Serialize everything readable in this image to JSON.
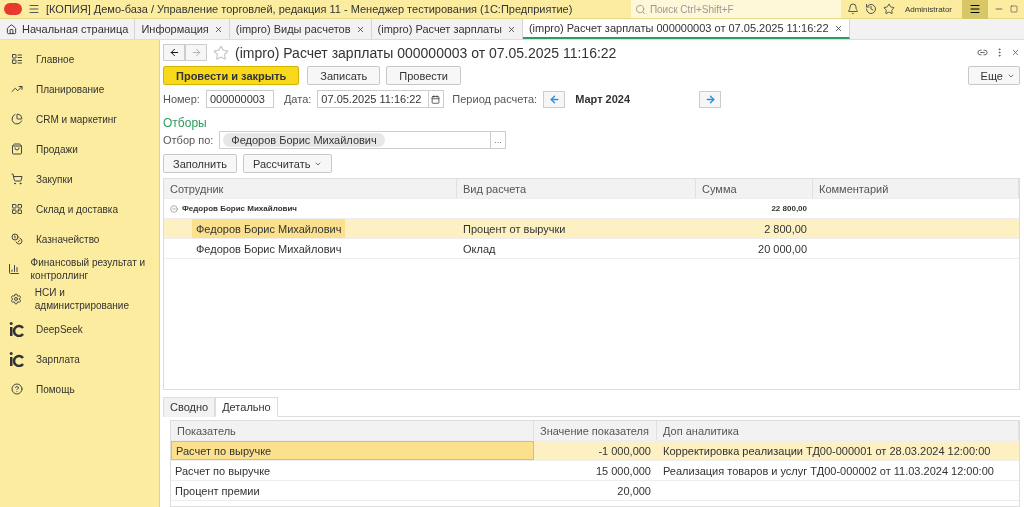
{
  "header": {
    "title": "[КОПИЯ] Демо-база / Управление торговлей, редакция 11  - Менеджер тестирования (1С:Предприятие)",
    "search_placeholder": "Поиск Ctrl+Shift+F",
    "user": "Administrator"
  },
  "tabs": [
    {
      "label": "Начальная страница",
      "selected": false,
      "closable": false
    },
    {
      "label": "Информация",
      "selected": false,
      "closable": true
    },
    {
      "label": "(impro) Виды расчетов",
      "selected": false,
      "closable": true
    },
    {
      "label": "(impro) Расчет зарплаты",
      "selected": false,
      "closable": true
    },
    {
      "label": "(impro) Расчет зарплаты 000000003 от 07.05.2025 11:16:22",
      "selected": true,
      "closable": true
    }
  ],
  "sidebar": {
    "items": [
      {
        "label": "Главное"
      },
      {
        "label": "Планирование"
      },
      {
        "label": "CRM и маркетинг"
      },
      {
        "label": "Продажи"
      },
      {
        "label": "Закупки"
      },
      {
        "label": "Склад и доставка"
      },
      {
        "label": "Казначейство"
      },
      {
        "label": "Финансовый результат и контроллинг"
      },
      {
        "label": "НСИ и администрирование"
      },
      {
        "label": "DeepSeek"
      },
      {
        "label": "Зарплата"
      },
      {
        "label": "Помощь"
      }
    ]
  },
  "form": {
    "title": "(impro) Расчет зарплаты 000000003 от 07.05.2025 11:16:22",
    "commands": [
      {
        "label": "Провести и закрыть",
        "kind": "primary"
      },
      {
        "label": "Записать",
        "kind": "normal"
      },
      {
        "label": "Провести",
        "kind": "normal"
      }
    ],
    "more": "Еще",
    "number_label": "Номер:",
    "number": "000000003",
    "date_label": "Дата:",
    "date": "07.05.2025 11:16:22",
    "period_label": "Период расчета:",
    "period": "Март 2024",
    "filters_heading": "Отборы",
    "filter_label": "Отбор по:",
    "filter_value": "Федоров Борис Михайлович",
    "filter_button": "...",
    "actions": [
      {
        "label": "Заполнить",
        "dropdown": false
      },
      {
        "label": "Рассчитать",
        "dropdown": true
      }
    ],
    "table": {
      "columns": [
        "Сотрудник",
        "Вид расчета",
        "Сумма",
        "Комментарий"
      ],
      "rows": [
        {
          "employee": "Федоров Борис Михайлович",
          "amount": "22 800,00",
          "expanded": true,
          "children": [
            {
              "employee": "Федоров Борис Михайлович",
              "calc_type": "Процент от выручки",
              "amount": "2 800,00",
              "selected": true
            },
            {
              "employee": "Федоров Борис Михайлович",
              "calc_type": "Оклад",
              "amount": "20 000,00",
              "selected": false
            }
          ]
        }
      ]
    },
    "detail_tabs": [
      {
        "label": "Сводно",
        "selected": false
      },
      {
        "label": "Детально",
        "selected": true
      }
    ],
    "detail_table": {
      "columns": [
        "Показатель",
        "Значение показателя",
        "Доп аналитика"
      ],
      "rows": [
        {
          "indicator": "Расчет по выручке",
          "value": "-1 000,000",
          "analytics": "Корректировка реализации ТД00-000001 от 28.03.2024 12:00:00",
          "selected": true
        },
        {
          "indicator": "Расчет по выручке",
          "value": "15 000,000",
          "analytics": "Реализация товаров и услуг ТД00-000002 от 11.03.2024 12:00:00",
          "selected": false
        },
        {
          "indicator": "Процент премии",
          "value": "20,000",
          "selected": false
        }
      ]
    }
  }
}
